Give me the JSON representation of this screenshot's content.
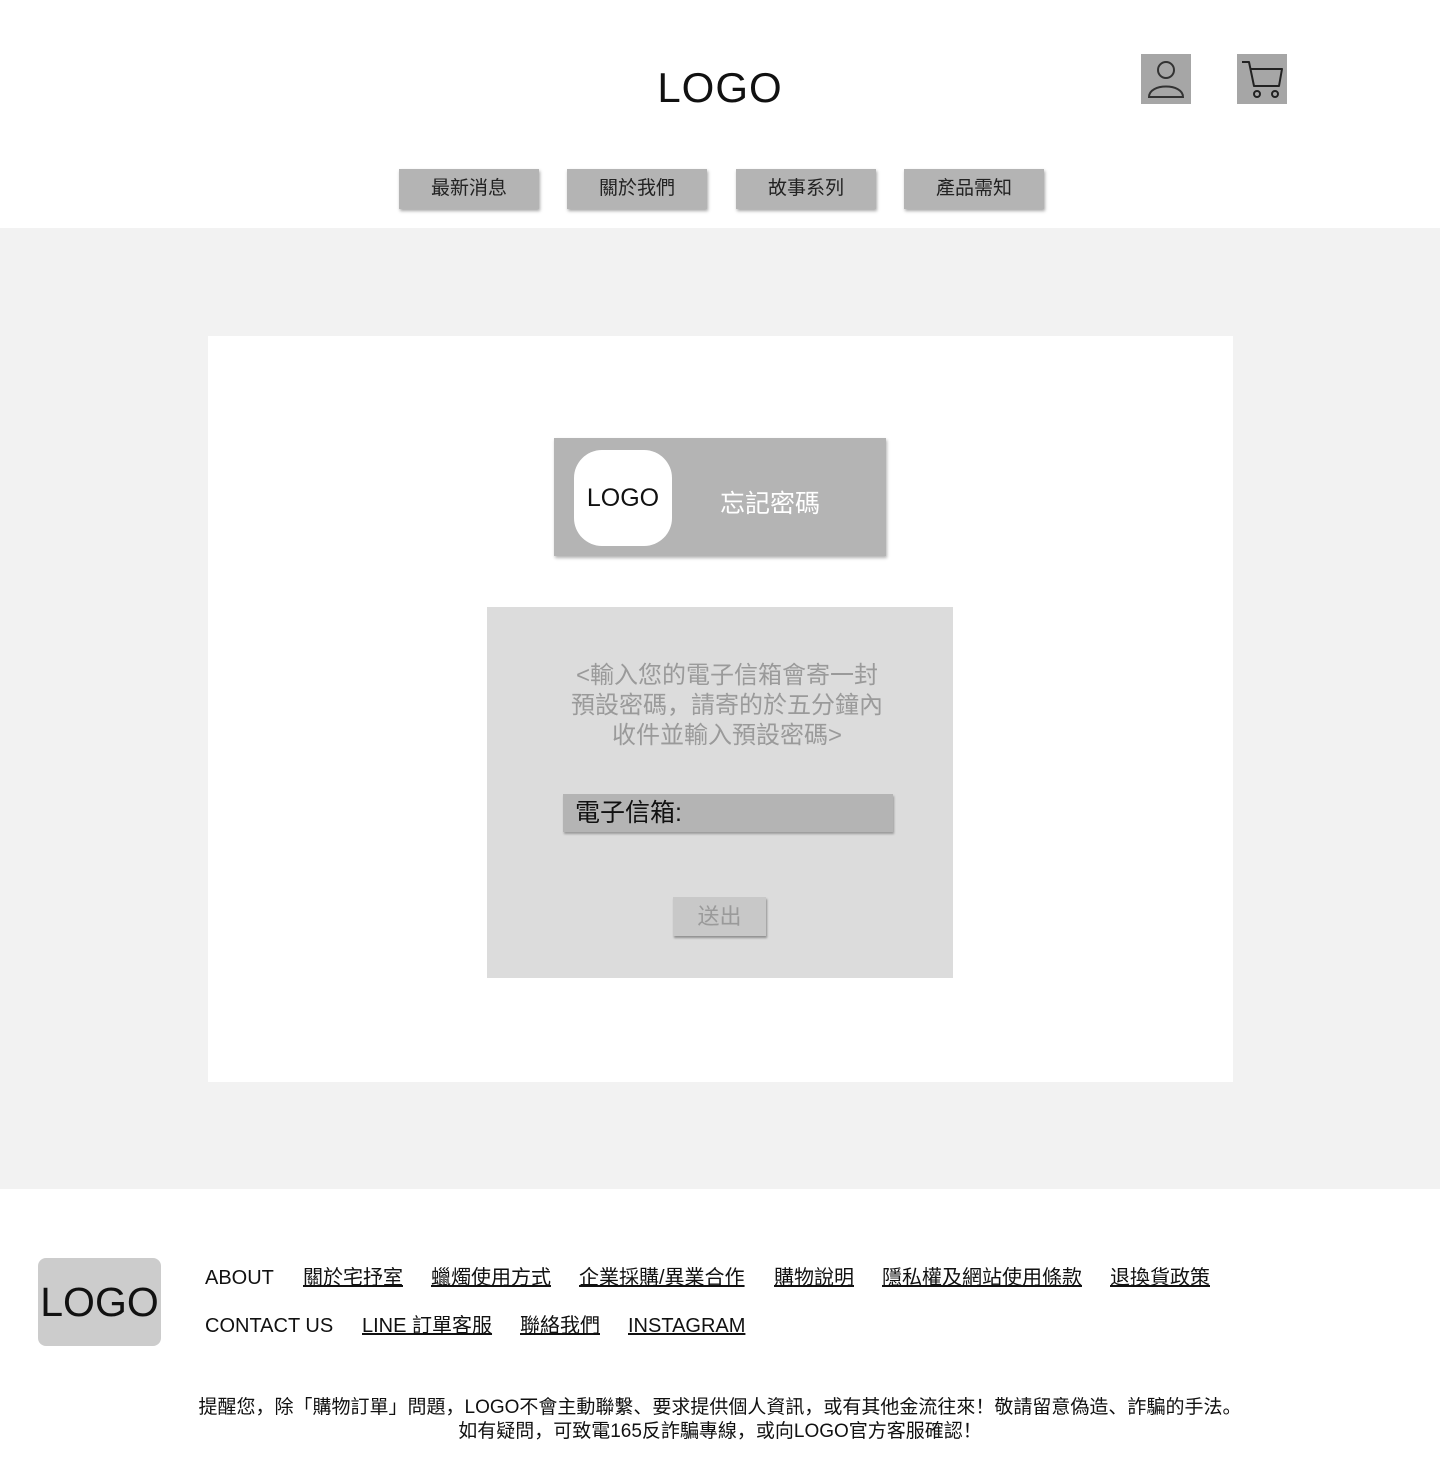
{
  "header": {
    "logo": "LOGO",
    "icons": {
      "user": "user-icon",
      "cart": "cart-icon"
    }
  },
  "nav": {
    "items": [
      {
        "label": "最新消息"
      },
      {
        "label": "關於我們"
      },
      {
        "label": "故事系列"
      },
      {
        "label": "產品需知"
      }
    ]
  },
  "main": {
    "title_logo": "LOGO",
    "title": "忘記密碼",
    "instructions": [
      "<輸入您的電子信箱會寄一封",
      "預設密碼，請寄的於五分鐘內",
      "收件並輸入預設密碼>"
    ],
    "email_label": "電子信箱:",
    "submit_label": "送出"
  },
  "footer": {
    "logo": "LOGO",
    "about_label": "ABOUT",
    "about_links": [
      {
        "label": "關於宅抒室"
      },
      {
        "label": "蠟燭使用方式"
      },
      {
        "label": "企業採購/異業合作"
      },
      {
        "label": "購物說明"
      },
      {
        "label": "隱私權及網站使用條款"
      },
      {
        "label": "退換貨政策"
      }
    ],
    "contact_label": "CONTACT US",
    "contact_links": [
      {
        "label": "LINE 訂單客服"
      },
      {
        "label": "聯絡我們"
      },
      {
        "label": "INSTAGRAM"
      }
    ],
    "notice_line1": "提醒您，除「購物訂單」問題，LOGO不會主動聯繫、要求提供個人資訊，或有其他金流往來！敬請留意偽造、詐騙的手法。",
    "notice_line2": "如有疑問，可致電165反詐騙專線，或向LOGO官方客服確認！"
  },
  "colors": {
    "page_bg": "#f2f2f2",
    "box_gray": "#b4b4b4",
    "form_bg": "#dcdcdc",
    "icon_bg": "#a6a6a6"
  }
}
